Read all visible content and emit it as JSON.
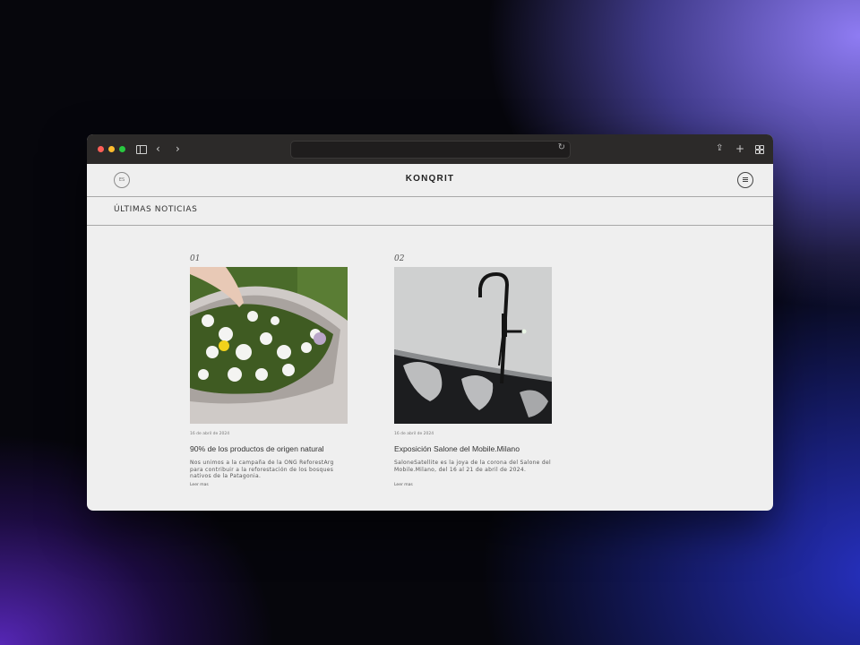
{
  "browser": {
    "icons": {
      "sidebar": "sidebar-icon",
      "back": "chevron-left-icon",
      "forward": "chevron-right-icon",
      "reload": "reload-icon",
      "share": "share-icon",
      "new_tab": "plus-icon",
      "tabs": "tab-overview-icon"
    },
    "back_glyph": "‹",
    "forward_glyph": "›",
    "reload_glyph": "↻",
    "share_glyph": "⇪",
    "plus_glyph": "+"
  },
  "site": {
    "lang": "ES",
    "logo": "KONQRIT",
    "section_title": "ÚLTIMAS NOTICIAS",
    "colors": {
      "page_bg": "#efefef",
      "text": "#333333",
      "divider": "#a8a8a8"
    }
  },
  "news": [
    {
      "number": "01",
      "image": "flowers-in-concrete-tub",
      "date": "16 de abril de 2024",
      "title": "90% de los productos de origen natural",
      "description": "Nos unimos a la campaña de la ONG ReforestArg para contribuir a la reforestación de los bosques nativos de la Patagonia.",
      "more": "Leer mas"
    },
    {
      "number": "02",
      "image": "black-faucet-marble-tub",
      "date": "16 de abril de 2024",
      "title": "Exposición Salone del Mobile.Milano",
      "description": "SaloneSatellite es la joya de la corona del Salone del Mobile.Milano, del 16 al 21 de abril de 2024.",
      "more": "Leer mas"
    }
  ]
}
